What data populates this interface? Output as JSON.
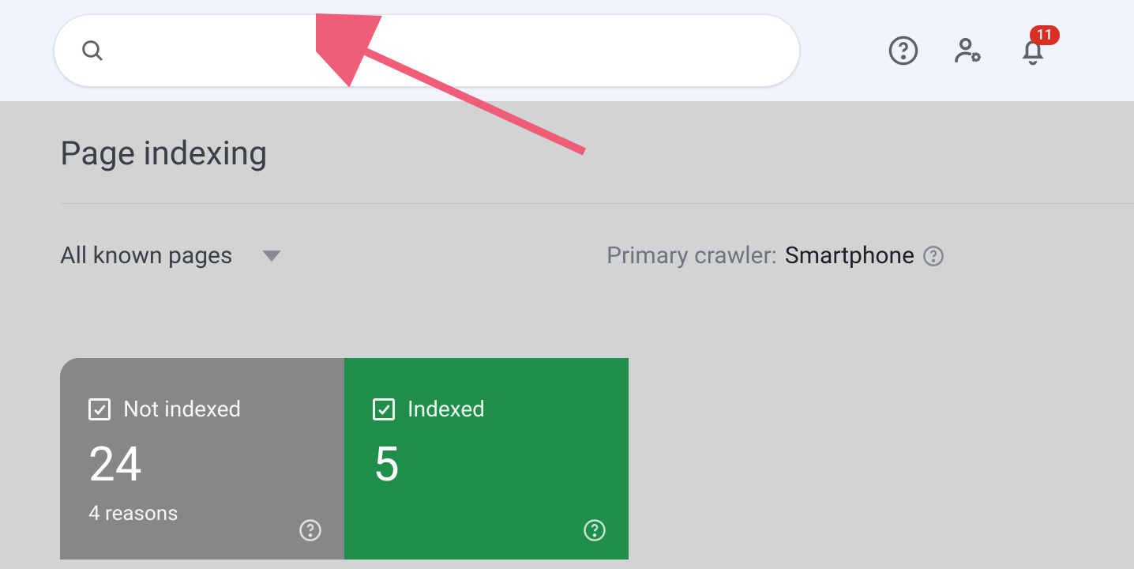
{
  "search": {
    "placeholder": ""
  },
  "header": {
    "notification_count": "11"
  },
  "page": {
    "title": "Page indexing"
  },
  "filter": {
    "dropdown_label": "All known pages",
    "crawler_label": "Primary crawler:",
    "crawler_value": "Smartphone"
  },
  "cards": {
    "not_indexed": {
      "label": "Not indexed",
      "count": "24",
      "reasons": "4 reasons"
    },
    "indexed": {
      "label": "Indexed",
      "count": "5"
    }
  }
}
